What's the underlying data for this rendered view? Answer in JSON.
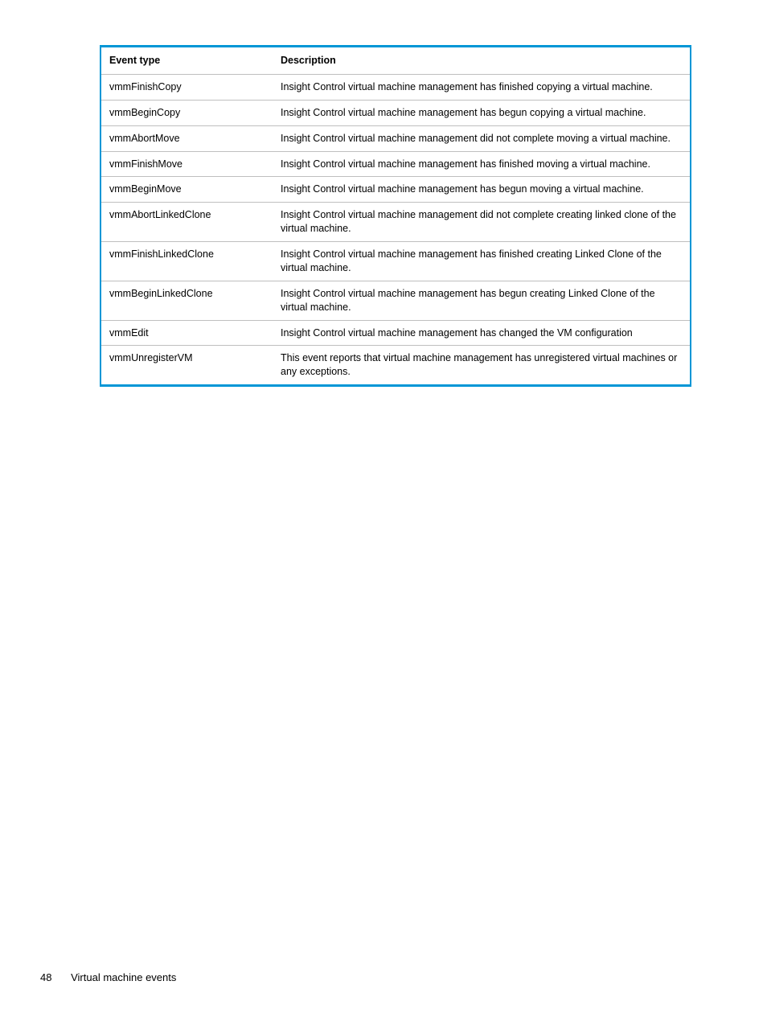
{
  "table": {
    "headers": {
      "event_type": "Event type",
      "description": "Description"
    },
    "rows": [
      {
        "event_type": "vmmFinishCopy",
        "description": "Insight Control virtual machine management has finished copying a virtual machine."
      },
      {
        "event_type": "vmmBeginCopy",
        "description": "Insight Control virtual machine management has begun copying a virtual machine."
      },
      {
        "event_type": "vmmAbortMove",
        "description": "Insight Control virtual machine management did not complete moving a virtual machine."
      },
      {
        "event_type": "vmmFinishMove",
        "description": "Insight Control virtual machine management has finished moving a virtual machine."
      },
      {
        "event_type": "vmmBeginMove",
        "description": "Insight Control virtual machine management has begun moving a virtual machine."
      },
      {
        "event_type": "vmmAbortLinkedClone",
        "description": "Insight Control virtual machine management did not complete creating linked clone of the virtual machine."
      },
      {
        "event_type": "vmmFinishLinkedClone",
        "description": "Insight Control virtual machine management has finished creating Linked Clone of the virtual machine."
      },
      {
        "event_type": "vmmBeginLinkedClone",
        "description": "Insight Control virtual machine management has begun creating Linked Clone of the virtual machine."
      },
      {
        "event_type": "vmmEdit",
        "description": "Insight Control virtual machine management has changed the VM configuration"
      },
      {
        "event_type": "vmmUnregisterVM",
        "description": "This event reports that virtual machine management has unregistered virtual machines or any exceptions."
      }
    ]
  },
  "footer": {
    "page_number": "48",
    "section_title": "Virtual machine events"
  }
}
